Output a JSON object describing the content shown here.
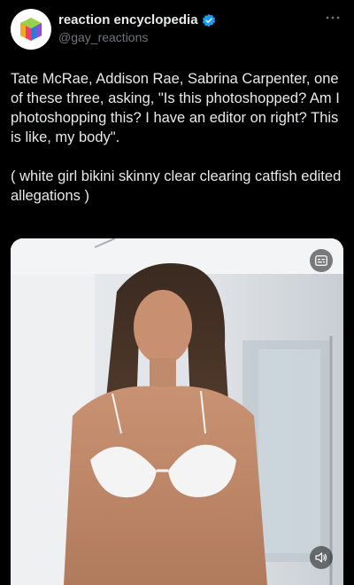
{
  "author": {
    "display_name": "reaction encyclopedia",
    "handle": "@gay_reactions",
    "verified": true,
    "verified_color": "#1d9bf0",
    "avatar_icon": "rainbow-cube-icon"
  },
  "tweet": {
    "paragraphs": [
      "Tate McRae, Addison Rae, Sabrina Carpenter, one of these three, asking, \"Is this photoshopped? Am I photoshopping this? I have an editor on right? This is like, my body\".",
      "( white girl bikini skinny clear clearing catfish edited allegations )"
    ]
  },
  "media": {
    "type": "video",
    "controls": [
      "captions-icon",
      "volume-icon"
    ]
  },
  "icons": {
    "more": "more-options-icon"
  }
}
